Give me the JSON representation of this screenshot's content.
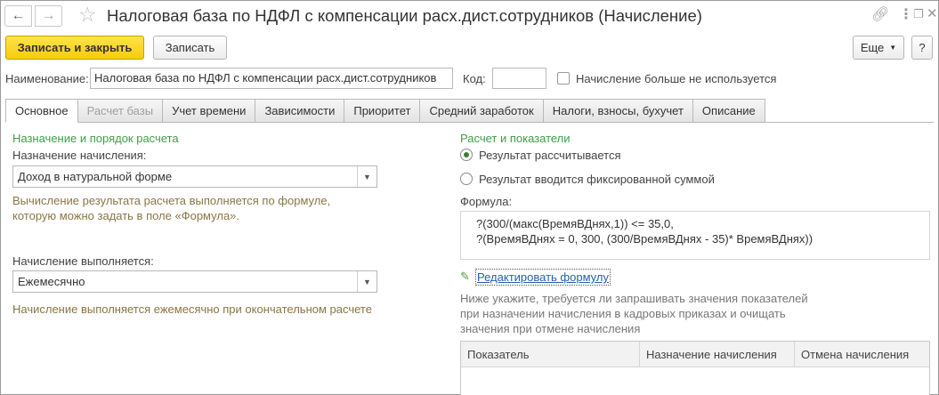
{
  "window": {
    "title": "Налоговая база по НДФЛ с компенсации расх.дист.сотрудников (Начисление)"
  },
  "icons": {
    "back": "arrow-left-icon",
    "forward": "arrow-right-icon",
    "favorite": "star-icon",
    "link": "link-icon",
    "more": "more-icon",
    "restore": "restore-icon",
    "close": "close-icon",
    "edit": "pencil-icon"
  },
  "colors": {
    "accent_primary": "#f6cc0c",
    "section_title": "#3e9f4a",
    "hint_text": "#8c7446",
    "link": "#2a5db0"
  },
  "toolbar": {
    "save_close_label": "Записать и закрыть",
    "save_label": "Записать",
    "more_label": "Еще",
    "help_label": "?"
  },
  "fields": {
    "name_label": "Наименование:",
    "name_value": "Налоговая база по НДФЛ с компенсации расх.дист.сотрудников",
    "code_label": "Код:",
    "code_value": "",
    "unused_label": "Начисление больше не используется"
  },
  "tabs": [
    {
      "label": "Основное"
    },
    {
      "label": "Расчет базы"
    },
    {
      "label": "Учет времени"
    },
    {
      "label": "Зависимости"
    },
    {
      "label": "Приоритет"
    },
    {
      "label": "Средний заработок"
    },
    {
      "label": "Налоги, взносы, бухучет"
    },
    {
      "label": "Описание"
    }
  ],
  "left": {
    "section_title": "Назначение и порядок расчета",
    "purpose_label": "Назначение начисления:",
    "purpose_value": "Доход в натуральной форме",
    "purpose_hint": "Вычисление результата расчета выполняется по формуле, которую можно задать в поле «Формула».",
    "schedule_label": "Начисление выполняется:",
    "schedule_value": "Ежемесячно",
    "schedule_hint": "Начисление выполняется ежемесячно при окончательном расчете"
  },
  "right": {
    "section_title": "Расчет и показатели",
    "radio_calculated": "Результат рассчитывается",
    "radio_fixed": "Результат вводится фиксированной суммой",
    "formula_label": "Формула:",
    "formula_text": "?(300/(макс(ВремяВДнях,1)) <= 35,0,\n?(ВремяВДнях = 0, 300, (300/ВремяВДнях - 35)* ВремяВДнях))",
    "edit_formula_link": "Редактировать формулу",
    "indicators_hint": "Ниже укажите, требуется ли запрашивать значения показателей при назначении начисления в кадровых приказах и очищать значения при отмене начисления",
    "grid_columns": [
      "Показатель",
      "Назначение начисления",
      "Отмена начисления"
    ]
  }
}
